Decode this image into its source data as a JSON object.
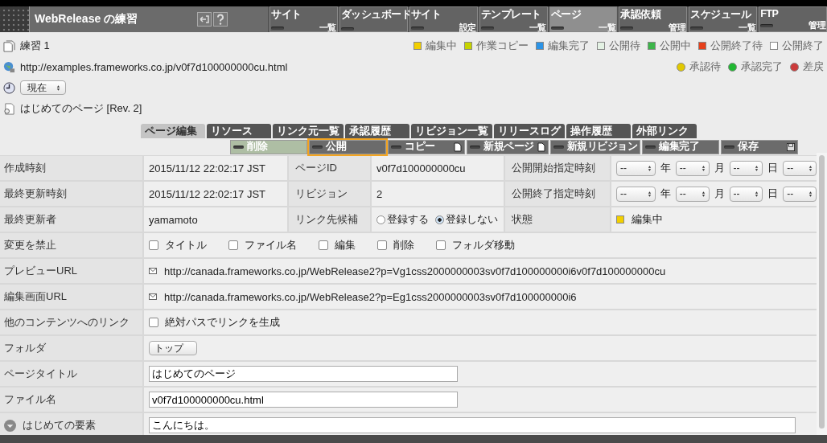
{
  "app": {
    "title": "WebRelease の練習"
  },
  "nav": [
    {
      "top": "サイト",
      "bottom": "一覧",
      "selected": false
    },
    {
      "top": "ダッシュボード",
      "selected": false
    },
    {
      "top": "サイト",
      "bottom": "設定",
      "selected": false
    },
    {
      "top": "テンプレート",
      "bottom": "一覧",
      "selected": false
    },
    {
      "top": "ページ",
      "bottom": "一覧",
      "selected": true
    },
    {
      "top": "承認依頼",
      "bottom": "管理",
      "selected": false
    },
    {
      "top": "スケジュール",
      "bottom": "一覧",
      "selected": false
    },
    {
      "top": "FTP",
      "bottom": "管理",
      "selected": false
    }
  ],
  "site_name": "練習 1",
  "site_url": "http://examples.frameworks.co.jp/v0f7d100000000cu.html",
  "time_select": "現在",
  "page_title": "はじめてのページ [Rev. 2]",
  "status_legend": [
    {
      "label": "編集中",
      "color": "#f2cf00"
    },
    {
      "label": "作業コピー",
      "color": "#c6d300"
    },
    {
      "label": "編集完了",
      "color": "#2b93e6"
    },
    {
      "label": "公開待",
      "color": "#e4f2e4"
    },
    {
      "label": "公開中",
      "color": "#3db54a"
    },
    {
      "label": "公開終了待",
      "color": "#e6401b"
    },
    {
      "label": "公開終了",
      "color": "#ffffff"
    }
  ],
  "approval_legend": [
    {
      "label": "承認待",
      "color": "#e2c900"
    },
    {
      "label": "承認完了",
      "color": "#20b832"
    },
    {
      "label": "差戻",
      "color": "#cc3b3b"
    }
  ],
  "tabs": [
    {
      "label": "ページ編集",
      "selected": true
    },
    {
      "label": "リソース",
      "selected": false
    },
    {
      "label": "リンク元一覧",
      "selected": false
    },
    {
      "label": "承認履歴",
      "selected": false
    },
    {
      "label": "リビジョン一覧",
      "selected": false
    },
    {
      "label": "リリースログ",
      "selected": false
    },
    {
      "label": "操作履歴",
      "selected": false
    },
    {
      "label": "外部リンク",
      "selected": false
    }
  ],
  "actions": [
    {
      "label": "削除",
      "kind": "plain",
      "disabled": true,
      "highlighted": false
    },
    {
      "label": "公開",
      "kind": "plain",
      "disabled": false,
      "highlighted": true
    },
    {
      "label": "コピー",
      "kind": "document",
      "disabled": false,
      "highlighted": false
    },
    {
      "label": "新規ページ",
      "kind": "document",
      "disabled": false,
      "highlighted": false
    },
    {
      "label": "新規リビジョン",
      "kind": "plain",
      "disabled": false,
      "highlighted": false
    },
    {
      "label": "編集完了",
      "kind": "plain",
      "disabled": false,
      "highlighted": false
    },
    {
      "label": "保存",
      "kind": "save",
      "disabled": false,
      "highlighted": false
    }
  ],
  "fields": [
    {
      "kind": "triple",
      "label": "作成時刻",
      "value": "2015/11/12 22:02:17 JST",
      "label2": "ページID",
      "value2": "v0f7d100000000cu",
      "label3": "公開開始指定時刻",
      "dates": [
        {
          "value": "--",
          "unit": "年"
        },
        {
          "value": "--",
          "unit": "月"
        },
        {
          "value": "--",
          "unit": "日"
        },
        {
          "value": "--"
        }
      ]
    },
    {
      "kind": "triple",
      "label": "最終更新時刻",
      "value": "2015/11/12 22:02:17 JST",
      "label2": "リビジョン",
      "value2": "2",
      "label3": "公開終了指定時刻",
      "dates": [
        {
          "value": "--",
          "unit": "年"
        },
        {
          "value": "--",
          "unit": "月"
        },
        {
          "value": "--",
          "unit": "日"
        },
        {
          "value": "--"
        }
      ]
    },
    {
      "kind": "triple",
      "label": "最終更新者",
      "value": "yamamoto",
      "label2": "リンク先候補",
      "radios": [
        {
          "label": "登録する",
          "selected": false
        },
        {
          "label": "登録しない",
          "selected": true
        }
      ],
      "label3": "状態",
      "status": {
        "label": "編集中",
        "color": "#f2cf00"
      }
    },
    {
      "kind": "checks",
      "label": "変更を禁止",
      "checks": [
        {
          "label": "タイトル",
          "checked": false
        },
        {
          "label": "ファイル名",
          "checked": false
        },
        {
          "label": "編集",
          "checked": false
        },
        {
          "label": "削除",
          "checked": false
        },
        {
          "label": "フォルダ移動",
          "checked": false
        }
      ]
    },
    {
      "kind": "url",
      "label": "プレビューURL",
      "value": "http://canada.frameworks.co.jp/WebRelease2?p=Vg1css2000000003sv0f7d100000000i6v0f7d100000000cu"
    },
    {
      "kind": "url",
      "label": "編集画面URL",
      "value": "http://canada.frameworks.co.jp/WebRelease2?p=Eg1css2000000003sv0f7d100000000i6"
    },
    {
      "kind": "checks",
      "label": "他のコンテンツへのリンク",
      "checks": [
        {
          "label": "絶対パスでリンクを生成",
          "checked": false
        }
      ]
    },
    {
      "kind": "select",
      "label": "フォルダ",
      "value": "トップ"
    },
    {
      "kind": "input",
      "label": "ページタイトル",
      "value": "はじめてのページ"
    },
    {
      "kind": "input",
      "label": "ファイル名",
      "value": "v0f7d100000000cu.html"
    },
    {
      "kind": "element",
      "label": "はじめての要素",
      "value": "こんにちは。"
    }
  ]
}
